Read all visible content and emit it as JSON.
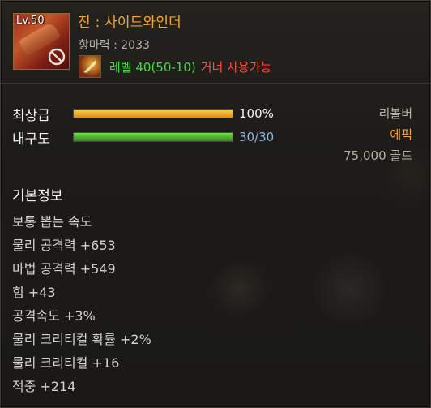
{
  "item": {
    "level_badge": "Lv.50",
    "name": "진 : 사이드와인더",
    "power": "항마력 : 2033",
    "requirement_level": "레벨 40(50-10)",
    "requirement_class": "거너 사용가능",
    "icon": "sidewinder-weapon-icon",
    "class_icon": "gunner-class-icon",
    "restricted_icon": "no-trade-icon"
  },
  "stats_bars": {
    "grade_label": "최상급",
    "grade_value": "100%",
    "grade_fill_fraction": 1.0,
    "durability_label": "내구도",
    "durability_value": "30/30",
    "durability_fill_fraction": 1.0
  },
  "right_info": {
    "type": "리볼버",
    "rarity": "에픽",
    "price": "75,000 골드"
  },
  "basic_info": {
    "title": "기본정보",
    "lines": [
      "보통 뽑는 속도",
      "물리 공격력 +653",
      "마법 공격력 +549",
      "힘 +43",
      "공격속도 +3%",
      "물리 크리티컬 확률 +2%",
      "물리 크리티컬 +16",
      "적중 +214"
    ]
  },
  "colors": {
    "item_name": "#f5a62a",
    "rarity_epic": "#f5a62a",
    "requirement_ok": "#3fe03a",
    "requirement_class": "#ff4a3a",
    "durability_value": "#8fb4d6"
  }
}
